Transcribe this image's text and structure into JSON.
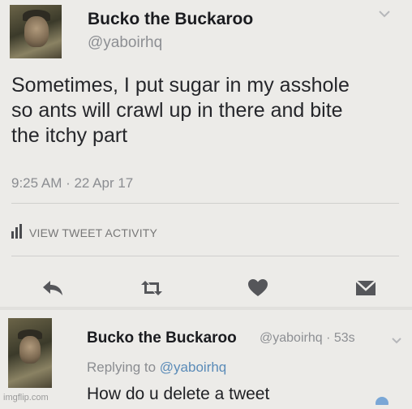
{
  "tweet": {
    "author_name": "Bucko the Buckaroo",
    "handle": "@yaboirhq",
    "text_lines": [
      "Sometimes, I put sugar in my asshole",
      "so ants will crawl up in there and bite",
      "the itchy part"
    ],
    "timestamp": "9:25 AM · 22 Apr 17",
    "activity_label": "VIEW TWEET ACTIVITY",
    "actions": [
      "reply-icon",
      "retweet-icon",
      "like-icon",
      "message-icon"
    ]
  },
  "reply": {
    "author_name": "Bucko the Buckaroo",
    "handle_time": "@yaboirhq · 53s",
    "replying_prefix": "Replying to",
    "replying_handle": "@yaboirhq",
    "text": "How do u delete a tweet"
  },
  "watermark": "imgflip.com"
}
